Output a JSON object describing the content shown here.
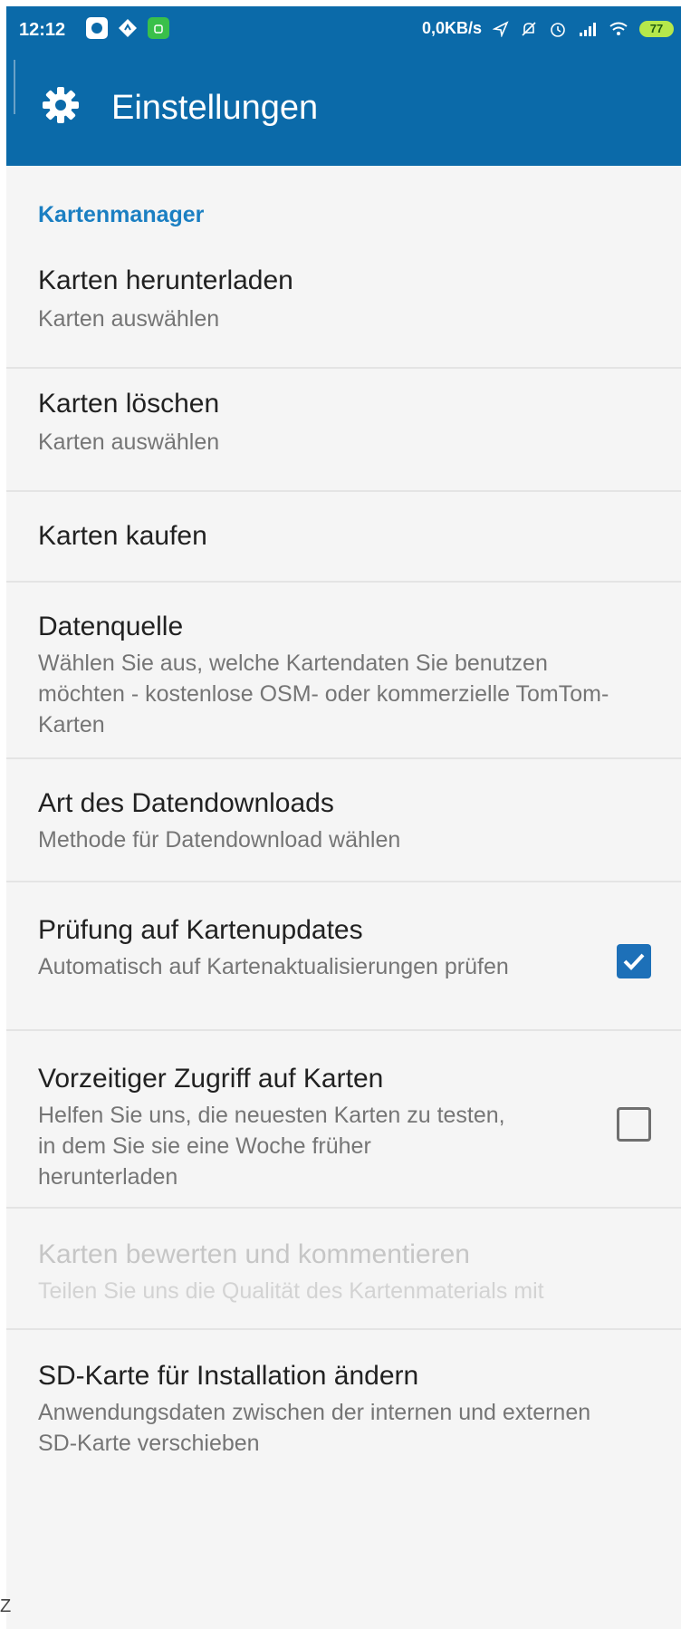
{
  "status_bar": {
    "time": "12:12",
    "net_speed": "0,0KB/s",
    "battery": "77"
  },
  "toolbar": {
    "title": "Einstellungen"
  },
  "category": {
    "label": "Kartenmanager"
  },
  "items": [
    {
      "title": "Karten herunterladen",
      "summary": "Karten auswählen"
    },
    {
      "title": "Karten löschen",
      "summary": "Karten auswählen"
    },
    {
      "title": "Karten kaufen"
    },
    {
      "title": "Datenquelle",
      "summary": "Wählen Sie aus, welche Kartendaten Sie benutzen möchten - kostenlose OSM- oder kommerzielle TomTom-Karten"
    },
    {
      "title": "Art des Datendownloads",
      "summary": "Methode für Datendownload wählen"
    },
    {
      "title": "Prüfung auf Kartenupdates",
      "summary": "Automatisch auf Kartenaktualisierungen prüfen",
      "checked": true
    },
    {
      "title": "Vorzeitiger Zugriff auf Karten",
      "summary": "Helfen Sie uns, die neuesten Karten zu testen, in dem Sie sie eine Woche früher herunterladen",
      "checked": false
    },
    {
      "title": "Karten bewerten und kommentieren",
      "summary": "Teilen Sie uns die Qualität des Kartenmaterials mit",
      "disabled": true
    },
    {
      "title": "SD-Karte für Installation ändern",
      "summary": "Anwendungsdaten zwischen der internen und externen SD-Karte verschieben"
    }
  ],
  "colors": {
    "app_bar": "#0b6aa9",
    "accent": "#1b7fc2",
    "checkbox": "#1d70b8"
  },
  "corner_mark": "Z"
}
